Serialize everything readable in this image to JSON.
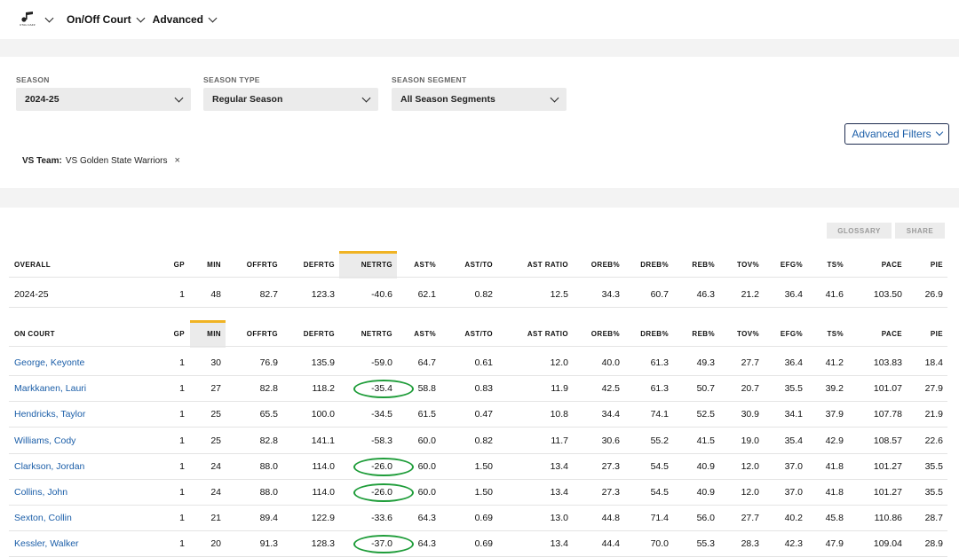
{
  "nav": {
    "logo_text": "UTAH JAZZ",
    "items": [
      {
        "label": "On/Off Court"
      },
      {
        "label": "Advanced"
      }
    ]
  },
  "filters": {
    "season": {
      "label": "SEASON",
      "value": "2024-25"
    },
    "season_type": {
      "label": "SEASON TYPE",
      "value": "Regular Season"
    },
    "season_segment": {
      "label": "SEASON SEGMENT",
      "value": "All Season Segments"
    },
    "advanced_filters_label": "Advanced Filters",
    "vs_team_key": "VS Team:",
    "vs_team_value": "VS Golden State Warriors",
    "remove_icon": "×"
  },
  "buttons": {
    "glossary": "GLOSSARY",
    "share": "SHARE"
  },
  "columns": [
    "GP",
    "MIN",
    "OFFRTG",
    "DEFRTG",
    "NETRTG",
    "AST%",
    "AST/TO",
    "AST RATIO",
    "OREB%",
    "DREB%",
    "REB%",
    "TOV%",
    "EFG%",
    "TS%",
    "PACE",
    "PIE"
  ],
  "overall": {
    "header": "OVERALL",
    "row": {
      "name": "2024-25",
      "values": [
        "1",
        "48",
        "82.7",
        "123.3",
        "-40.6",
        "62.1",
        "0.82",
        "12.5",
        "34.3",
        "60.7",
        "46.3",
        "21.2",
        "36.4",
        "41.6",
        "103.50",
        "26.9"
      ]
    }
  },
  "on_court": {
    "header": "ON COURT",
    "rows": [
      {
        "name": "George, Keyonte",
        "values": [
          "1",
          "30",
          "76.9",
          "135.9",
          "-59.0",
          "64.7",
          "0.61",
          "12.0",
          "40.0",
          "61.3",
          "49.3",
          "27.7",
          "36.4",
          "41.2",
          "103.83",
          "18.4"
        ]
      },
      {
        "name": "Markkanen, Lauri",
        "values": [
          "1",
          "27",
          "82.8",
          "118.2",
          "-35.4",
          "58.8",
          "0.83",
          "11.9",
          "42.5",
          "61.3",
          "50.7",
          "20.7",
          "35.5",
          "39.2",
          "101.07",
          "27.9"
        ]
      },
      {
        "name": "Hendricks, Taylor",
        "values": [
          "1",
          "25",
          "65.5",
          "100.0",
          "-34.5",
          "61.5",
          "0.47",
          "10.8",
          "34.4",
          "74.1",
          "52.5",
          "30.9",
          "34.1",
          "37.9",
          "107.78",
          "21.9"
        ]
      },
      {
        "name": "Williams, Cody",
        "values": [
          "1",
          "25",
          "82.8",
          "141.1",
          "-58.3",
          "60.0",
          "0.82",
          "11.7",
          "30.6",
          "55.2",
          "41.5",
          "19.0",
          "35.4",
          "42.9",
          "108.57",
          "22.6"
        ]
      },
      {
        "name": "Clarkson, Jordan",
        "values": [
          "1",
          "24",
          "88.0",
          "114.0",
          "-26.0",
          "60.0",
          "1.50",
          "13.4",
          "27.3",
          "54.5",
          "40.9",
          "12.0",
          "37.0",
          "41.8",
          "101.27",
          "35.5"
        ]
      },
      {
        "name": "Collins, John",
        "values": [
          "1",
          "24",
          "88.0",
          "114.0",
          "-26.0",
          "60.0",
          "1.50",
          "13.4",
          "27.3",
          "54.5",
          "40.9",
          "12.0",
          "37.0",
          "41.8",
          "101.27",
          "35.5"
        ]
      },
      {
        "name": "Sexton, Collin",
        "values": [
          "1",
          "21",
          "89.4",
          "122.9",
          "-33.6",
          "64.3",
          "0.69",
          "13.0",
          "44.8",
          "71.4",
          "56.0",
          "27.7",
          "40.2",
          "45.8",
          "110.86",
          "28.7"
        ]
      },
      {
        "name": "Kessler, Walker",
        "values": [
          "1",
          "20",
          "91.3",
          "128.3",
          "-37.0",
          "64.3",
          "0.69",
          "13.4",
          "44.4",
          "70.0",
          "55.3",
          "28.3",
          "42.3",
          "47.9",
          "109.04",
          "28.9"
        ]
      }
    ],
    "circled_netrtg_rows": [
      1,
      4,
      5,
      7
    ],
    "circle_color": "#1f9d3a",
    "sorted_column_overall": "NETRTG",
    "sorted_column_on_court": "MIN",
    "sort_accent_color": "#f0b323",
    "link_color": "#1b5ea8"
  }
}
